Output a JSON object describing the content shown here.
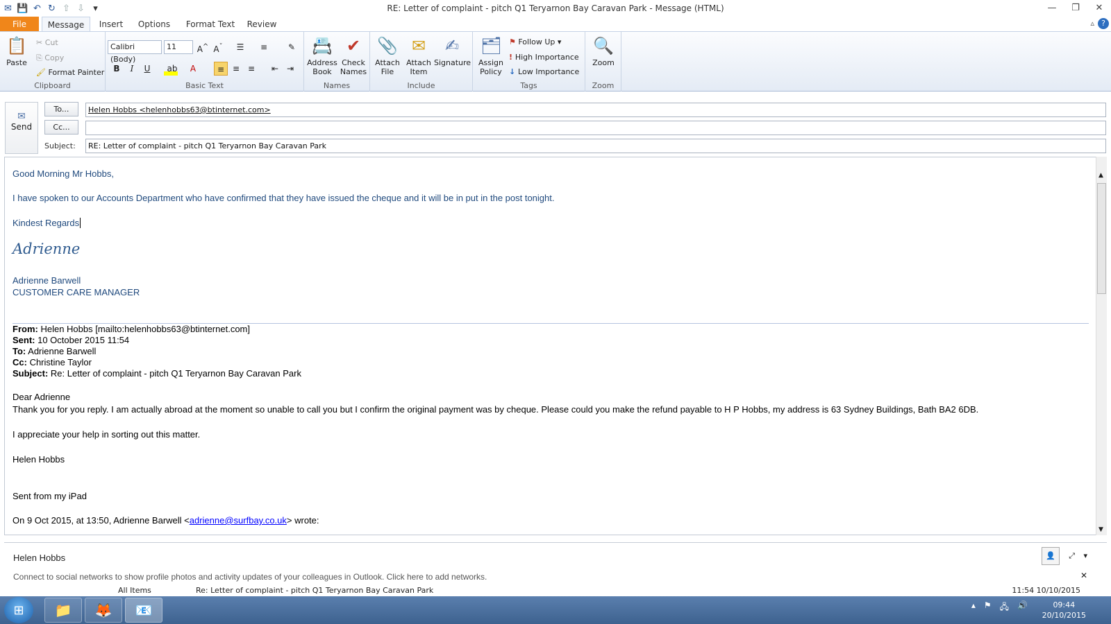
{
  "window": {
    "title": "RE: Letter of complaint - pitch Q1 Teryarnon Bay Caravan Park  -  Message (HTML)"
  },
  "tabs": [
    "File",
    "Message",
    "Insert",
    "Options",
    "Format Text",
    "Review"
  ],
  "ribbon": {
    "clipboard": {
      "paste": "Paste",
      "cut": "Cut",
      "copy": "Copy",
      "format_painter": "Format Painter",
      "label": "Clipboard"
    },
    "basic_text": {
      "font": "Calibri (Body)",
      "size": "11",
      "label": "Basic Text"
    },
    "names": {
      "address_book": "Address\nBook",
      "check_names": "Check\nNames",
      "label": "Names"
    },
    "include": {
      "attach_file": "Attach\nFile",
      "attach_item": "Attach\nItem",
      "signature": "Signature",
      "label": "Include"
    },
    "tags": {
      "assign_policy": "Assign\nPolicy",
      "follow_up": "Follow Up",
      "high": "High Importance",
      "low": "Low Importance",
      "label": "Tags"
    },
    "zoom": {
      "zoom": "Zoom",
      "label": "Zoom"
    }
  },
  "header": {
    "send": "Send",
    "to_btn": "To...",
    "cc_btn": "Cc...",
    "subject_lbl": "Subject:",
    "to_value": "Helen Hobbs <helenhobbs63@btinternet.com>",
    "cc_value": "",
    "subject_value": "RE: Letter of complaint - pitch Q1 Teryarnon Bay Caravan Park"
  },
  "body": {
    "greeting": "Good Morning Mr Hobbs,",
    "para1": "I have spoken to our Accounts Department who have confirmed that they have issued the cheque and it will be in put in the post tonight.",
    "regards": "Kindest Regards",
    "signature": "Adrienne",
    "sig_name": "Adrienne Barwell",
    "sig_title": "CUSTOMER CARE MANAGER",
    "from_lbl": "From:",
    "from_val": " Helen Hobbs [mailto:helenhobbs63@btinternet.com]",
    "sent_lbl": "Sent:",
    "sent_val": " 10 October 2015 11:54",
    "to_lbl": "To:",
    "to_val": " Adrienne Barwell",
    "cc_lbl": "Cc:",
    "cc_val": " Christine Taylor",
    "subj_lbl": "Subject:",
    "subj_val": " Re: Letter of complaint - pitch Q1 Teryarnon Bay Caravan Park",
    "dear": "Dear Adrienne",
    "thanks": "Thank you for you reply. I am actually abroad at the moment so unable to call you but I confirm the original payment was by cheque. Please could you make the refund payable to H P Hobbs, my address is 63 Sydney Buildings, Bath BA2 6DB.",
    "appreciate": "I appreciate your help in sorting out this matter.",
    "name": "Helen Hobbs",
    "ipad": "Sent from my iPad",
    "wrote_pre": "On 9 Oct 2015, at 13:50, Adrienne Barwell <",
    "wrote_link": "adrienne@surfbay.co.uk",
    "wrote_post": "> wrote:"
  },
  "people_pane": {
    "name": "Helen Hobbs",
    "notice": "Connect to social networks to show profile photos and activity updates of your colleagues in Outlook. Click here to add networks.",
    "all_items": "All Items",
    "item_subject": "Re: Letter of complaint - pitch Q1 Teryarnon Bay Caravan Park",
    "item_time": "11:54 10/10/2015"
  },
  "taskbar": {
    "time": "09:44",
    "date": "20/10/2015"
  }
}
